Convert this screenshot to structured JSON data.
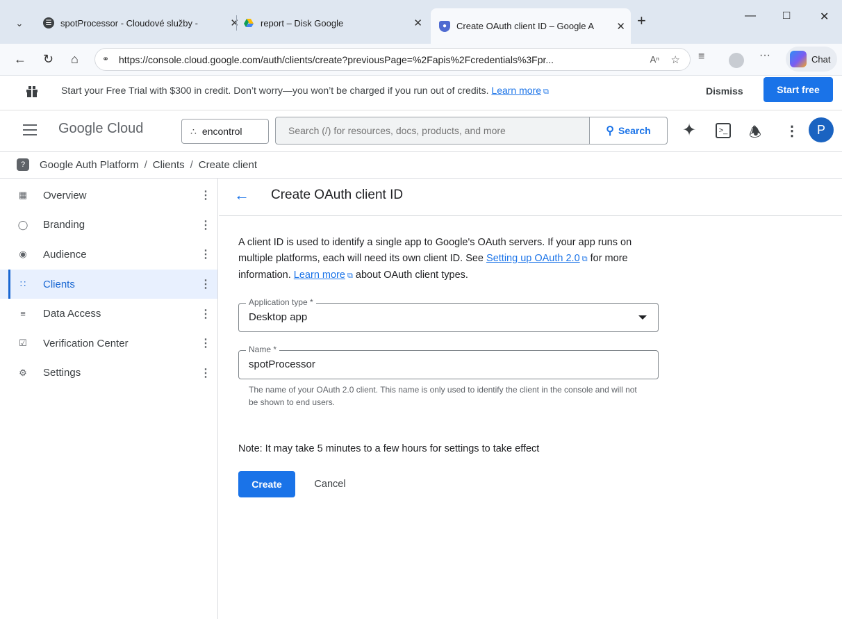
{
  "browser": {
    "tabs": [
      {
        "title": "spotProcessor - Cloudové služby -",
        "close": "✕"
      },
      {
        "title": "report – Disk Google",
        "close": "✕"
      },
      {
        "title": "Create OAuth client ID – Google A",
        "close": "✕"
      }
    ],
    "new_tab": "+",
    "url": "https://console.cloud.google.com/auth/clients/create?previousPage=%2Fapis%2Fcredentials%3Fpr...",
    "chat_label": "Chat"
  },
  "banner": {
    "text": "Start your Free Trial with $300 in credit. Don’t worry—you won’t be charged if you run out of credits.",
    "learn_more": "Learn more",
    "dismiss": "Dismiss",
    "start_free": "Start free"
  },
  "header": {
    "logo_google": "Google",
    "logo_cloud": "Cloud",
    "project": "encontrol",
    "search_placeholder": "Search (/) for resources, docs, products, and more",
    "search_button": "Search",
    "avatar_letter": "P"
  },
  "breadcrumb": [
    "Google Auth Platform",
    "Clients",
    "Create client"
  ],
  "sidebar": {
    "items": [
      {
        "label": "Overview",
        "icon": "dashboard-icon"
      },
      {
        "label": "Branding",
        "icon": "palette-icon"
      },
      {
        "label": "Audience",
        "icon": "account-circle-icon"
      },
      {
        "label": "Clients",
        "icon": "grid-icon",
        "active": true
      },
      {
        "label": "Data Access",
        "icon": "data-settings-icon"
      },
      {
        "label": "Verification Center",
        "icon": "verified-box-icon"
      },
      {
        "label": "Settings",
        "icon": "gear-icon"
      }
    ]
  },
  "main": {
    "title": "Create OAuth client ID",
    "desc_1": "A client ID is used to identify a single app to Google's OAuth servers. If your app runs on multiple platforms, each will need its own client ID. See",
    "desc_link1": "Setting up OAuth 2.0",
    "desc_2": "for more information.",
    "desc_link2": "Learn more",
    "desc_3": "about OAuth client types.",
    "app_type_label": "Application type *",
    "app_type_value": "Desktop app",
    "name_label": "Name *",
    "name_value": "spotProcessor",
    "name_hint": "The name of your OAuth 2.0 client. This name is only used to identify the client in the console and will not be shown to end users.",
    "note": "Note: It may take 5 minutes to a few hours for settings to take effect",
    "create_button": "Create",
    "cancel_button": "Cancel"
  },
  "colors": {
    "accent": "#1a73e8",
    "nav_active_bg": "#e8f0fe",
    "tabbar_bg": "#dfe7f1"
  }
}
